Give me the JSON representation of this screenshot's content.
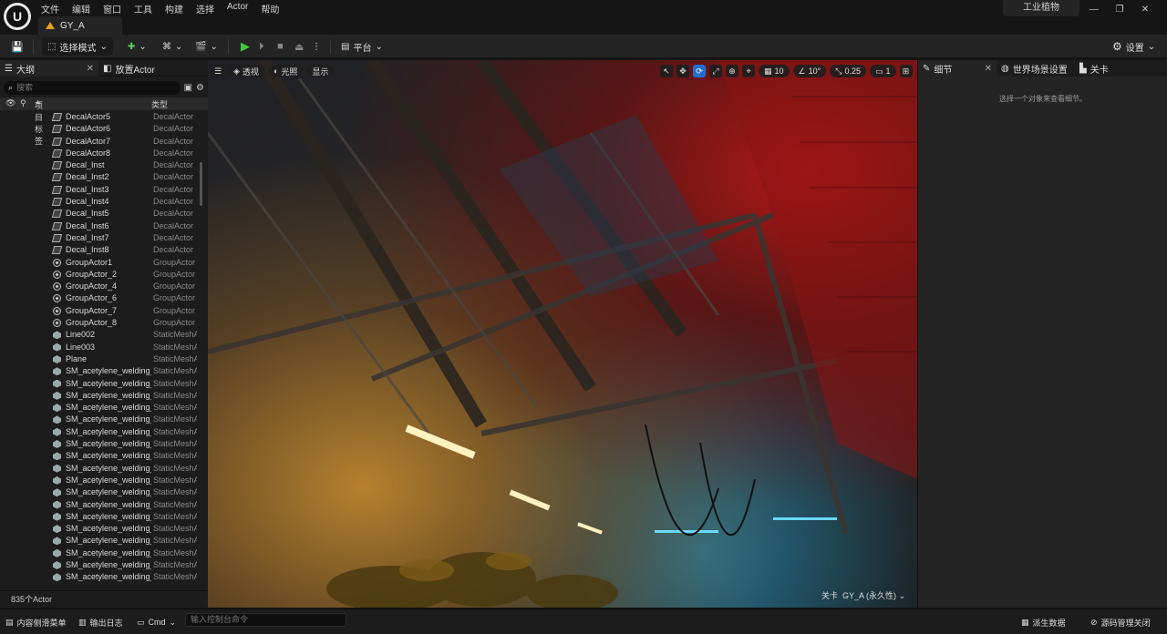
{
  "menubar": {
    "logo_glyph": "U",
    "items": [
      "文件",
      "编辑",
      "窗口",
      "工具",
      "构建",
      "选择",
      "Actor",
      "帮助"
    ],
    "level_tab": "GY_A",
    "project_name": "工业植物",
    "window_controls": [
      "—",
      "❐",
      "✕"
    ]
  },
  "toolbar": {
    "save_icon": "💾",
    "mode_label": "选择模式",
    "platform_label": "平台",
    "settings_label": "设置",
    "play_glyph": "▶",
    "step_glyph": "⏵",
    "stop_glyph": "■",
    "eject_glyph": "⏏",
    "more_glyph": "⋮"
  },
  "outliner": {
    "tab_outline": "大纲",
    "tab_place": "放置Actor",
    "search_placeholder": "搜索",
    "col_label": "项目标签",
    "col_type": "类型",
    "sort_glyph": "▲",
    "rows": [
      {
        "name": "DecalActor5",
        "type": "DecalActor",
        "icon": "decal"
      },
      {
        "name": "DecalActor6",
        "type": "DecalActor",
        "icon": "decal"
      },
      {
        "name": "DecalActor7",
        "type": "DecalActor",
        "icon": "decal"
      },
      {
        "name": "DecalActor8",
        "type": "DecalActor",
        "icon": "decal"
      },
      {
        "name": "Decal_Inst",
        "type": "DecalActor",
        "icon": "decal"
      },
      {
        "name": "Decal_Inst2",
        "type": "DecalActor",
        "icon": "decal"
      },
      {
        "name": "Decal_Inst3",
        "type": "DecalActor",
        "icon": "decal"
      },
      {
        "name": "Decal_Inst4",
        "type": "DecalActor",
        "icon": "decal"
      },
      {
        "name": "Decal_Inst5",
        "type": "DecalActor",
        "icon": "decal"
      },
      {
        "name": "Decal_Inst6",
        "type": "DecalActor",
        "icon": "decal"
      },
      {
        "name": "Decal_Inst7",
        "type": "DecalActor",
        "icon": "decal"
      },
      {
        "name": "Decal_Inst8",
        "type": "DecalActor",
        "icon": "decal"
      },
      {
        "name": "GroupActor1",
        "type": "GroupActor",
        "icon": "group"
      },
      {
        "name": "GroupActor_2",
        "type": "GroupActor",
        "icon": "group"
      },
      {
        "name": "GroupActor_4",
        "type": "GroupActor",
        "icon": "group"
      },
      {
        "name": "GroupActor_6",
        "type": "GroupActor",
        "icon": "group"
      },
      {
        "name": "GroupActor_7",
        "type": "GroupActor",
        "icon": "group"
      },
      {
        "name": "GroupActor_8",
        "type": "GroupActor",
        "icon": "group"
      },
      {
        "name": "Line002",
        "type": "StaticMeshA",
        "icon": "mesh"
      },
      {
        "name": "Line003",
        "type": "StaticMeshA",
        "icon": "mesh"
      },
      {
        "name": "Plane",
        "type": "StaticMeshA",
        "icon": "mesh"
      },
      {
        "name": "SM_acetylene_welding_",
        "type": "StaticMeshA",
        "icon": "mesh"
      },
      {
        "name": "SM_acetylene_welding_",
        "type": "StaticMeshA",
        "icon": "mesh"
      },
      {
        "name": "SM_acetylene_welding_",
        "type": "StaticMeshA",
        "icon": "mesh"
      },
      {
        "name": "SM_acetylene_welding_",
        "type": "StaticMeshA",
        "icon": "mesh"
      },
      {
        "name": "SM_acetylene_welding_",
        "type": "StaticMeshA",
        "icon": "mesh"
      },
      {
        "name": "SM_acetylene_welding_",
        "type": "StaticMeshA",
        "icon": "mesh"
      },
      {
        "name": "SM_acetylene_welding_",
        "type": "StaticMeshA",
        "icon": "mesh"
      },
      {
        "name": "SM_acetylene_welding_",
        "type": "StaticMeshA",
        "icon": "mesh"
      },
      {
        "name": "SM_acetylene_welding_",
        "type": "StaticMeshA",
        "icon": "mesh"
      },
      {
        "name": "SM_acetylene_welding_",
        "type": "StaticMeshA",
        "icon": "mesh"
      },
      {
        "name": "SM_acetylene_welding_",
        "type": "StaticMeshA",
        "icon": "mesh"
      },
      {
        "name": "SM_acetylene_welding_",
        "type": "StaticMeshA",
        "icon": "mesh"
      },
      {
        "name": "SM_acetylene_welding_",
        "type": "StaticMeshA",
        "icon": "mesh"
      },
      {
        "name": "SM_acetylene_welding_",
        "type": "StaticMeshA",
        "icon": "mesh"
      },
      {
        "name": "SM_acetylene_welding_",
        "type": "StaticMeshA",
        "icon": "mesh"
      },
      {
        "name": "SM_acetylene_welding_",
        "type": "StaticMeshA",
        "icon": "mesh"
      },
      {
        "name": "SM_acetylene_welding_",
        "type": "StaticMeshA",
        "icon": "mesh"
      },
      {
        "name": "SM_acetylene_welding_",
        "type": "StaticMeshA",
        "icon": "mesh"
      },
      {
        "name": "SM_acetylene_welding_",
        "type": "StaticMeshA",
        "icon": "mesh"
      }
    ],
    "actor_count": "835个Actor"
  },
  "viewport": {
    "menu_glyph": "☰",
    "perspective_label": "透视",
    "lighting_label": "光照",
    "show_label": "显示",
    "grid_snap": "10",
    "rotation_snap": "10°",
    "scale_snap": "0.25",
    "camera_speed": "1",
    "level_label": "关卡",
    "level_name": "GY_A (永久性)"
  },
  "details": {
    "tab_details": "细节",
    "tab_world": "世界场景设置",
    "tab_level": "关卡",
    "empty_message": "选择一个对象来查看细节。"
  },
  "bottombar": {
    "content_drawer": "内容侧滑菜单",
    "output_log": "输出日志",
    "cmd_label": "Cmd",
    "console_placeholder": "输入控制台命令",
    "derived_data": "派生数据",
    "source_control": "源码管理关闭"
  },
  "colors": {
    "accent_blue": "#1e6fd0",
    "play_green": "#3ec93e",
    "warning_orange": "#e0a020"
  }
}
